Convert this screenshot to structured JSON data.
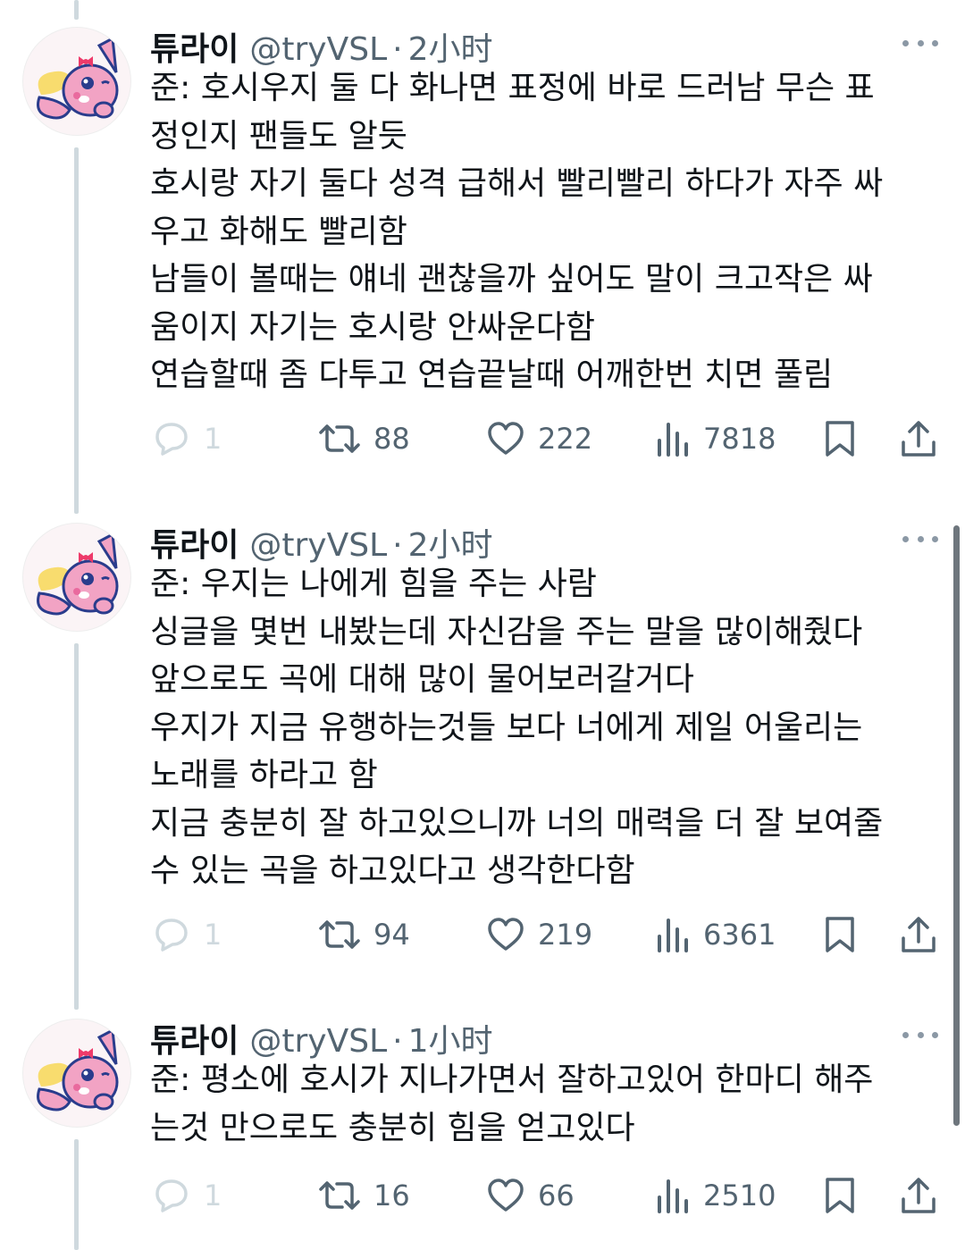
{
  "tweets": [
    {
      "name": "튜라이",
      "handle": "@tryVSL",
      "dot": "·",
      "time": "2小时",
      "lines": [
        "준: 호시우지 둘 다 화나면 표정에 바로 드러남 무슨 표",
        "정인지 팬들도 알듯",
        "호시랑 자기 둘다 성격 급해서 빨리빨리 하다가 자주 싸",
        "우고 화해도 빨리함",
        "남들이 볼때는 얘네 괜찮을까 싶어도 말이 크고작은 싸",
        "움이지 자기는 호시랑 안싸운다함",
        "연습할때 좀 다투고 연습끝날때 어깨한번 치면 풀림"
      ],
      "replies": "1",
      "retweets": "88",
      "likes": "222",
      "views": "7818"
    },
    {
      "name": "튜라이",
      "handle": "@tryVSL",
      "dot": "·",
      "time": "2小时",
      "lines": [
        "준: 우지는 나에게 힘을 주는 사람",
        "싱글을 몇번 내봤는데 자신감을 주는 말을 많이해줬다",
        "앞으로도 곡에 대해 많이 물어보러갈거다",
        "우지가 지금 유행하는것들 보다 너에게 제일 어울리는",
        "노래를 하라고 함",
        "지금 충분히 잘 하고있으니까 너의 매력을 더 잘 보여줄",
        "수 있는 곡을 하고있다고 생각한다함"
      ],
      "replies": "1",
      "retweets": "94",
      "likes": "219",
      "views": "6361"
    },
    {
      "name": "튜라이",
      "handle": "@tryVSL",
      "dot": "·",
      "time": "1小时",
      "lines": [
        "준: 평소에 호시가 지나가면서 잘하고있어 한마디 해주",
        "는것 만으로도 충분히  힘을 얻고있다"
      ],
      "replies": "1",
      "retweets": "16",
      "likes": "66",
      "views": "2510"
    }
  ],
  "icons": {
    "reply": "reply-icon",
    "retweet": "retweet-icon",
    "like": "heart-icon",
    "views": "views-chart-icon",
    "bookmark": "bookmark-icon",
    "share": "share-icon",
    "more": "more-dots-icon"
  },
  "colors": {
    "text": "#0f1419",
    "secondary": "#536471",
    "faint": "#cfd9de",
    "avatar_pink": "#f2a3c4",
    "avatar_blue": "#2a3c8c",
    "avatar_yellow": "#f8dc6e"
  }
}
